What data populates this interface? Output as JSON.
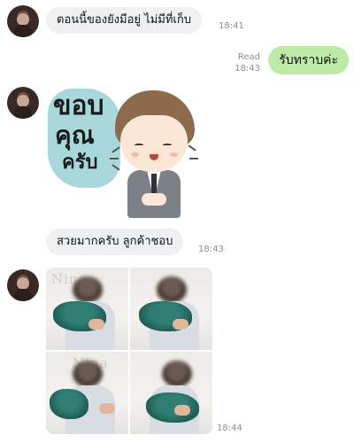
{
  "messages": [
    {
      "direction": "in",
      "text": "ตอนนี้ของยังมีอยู่ ไม่มีที่เก็บ",
      "time": "18:41"
    },
    {
      "direction": "out",
      "text": "รับทราบค่ะ",
      "status": "Read",
      "time": "18:43"
    },
    {
      "direction": "in",
      "type": "sticker",
      "sticker_text": [
        "ขอบ",
        "คุณ",
        "ครับ"
      ]
    },
    {
      "direction": "in",
      "text": "สวยมากครับ ลูกค้าชอบ",
      "time": "18:43"
    },
    {
      "direction": "in",
      "type": "photo-grid",
      "watermark": "Nina",
      "time": "18:44"
    }
  ],
  "colors": {
    "incoming_bubble": "#eef0f2",
    "outgoing_bubble": "#bdeaa6",
    "timestamp": "#8a8f94"
  }
}
